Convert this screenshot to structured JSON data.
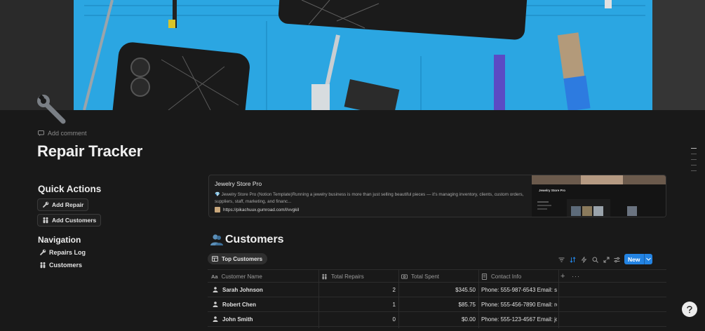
{
  "page": {
    "title": "Repair Tracker",
    "add_comment": "Add comment",
    "icon": "wrench-icon"
  },
  "quick_actions": {
    "heading": "Quick Actions",
    "buttons": [
      {
        "label": "Add Repair",
        "icon": "wrench-icon"
      },
      {
        "label": "Add Customers",
        "icon": "people-icon"
      }
    ]
  },
  "navigation": {
    "heading": "Navigation",
    "links": [
      {
        "label": "Repairs Log",
        "icon": "wrench-icon"
      },
      {
        "label": "Customers",
        "icon": "people-icon"
      }
    ]
  },
  "bookmark": {
    "title": "Jewelry Store Pro",
    "description": "💎 Jewelry Store Pro (Notion Template)Running a jewelry business is more than just selling beautiful pieces — it's managing inventory, clients, custom orders, suppliers, staff, marketing, and financ...",
    "url": "https://pikachuux.gumroad.com/l/vvgkil",
    "thumb_title": "Jewelry Store Pro"
  },
  "database": {
    "title": "Customers",
    "view_tab": "Top Customers",
    "new_label": "New",
    "columns": [
      {
        "label": "Customer Name",
        "icon": "text-icon"
      },
      {
        "label": "Total Repairs",
        "icon": "people-icon"
      },
      {
        "label": "Total Spent",
        "icon": "money-icon"
      },
      {
        "label": "Contact Info",
        "icon": "document-icon"
      }
    ],
    "rows": [
      {
        "name": "Sarah Johnson",
        "repairs": "2",
        "spent": "$345.50",
        "contact": "Phone: 555-987-6543 Email: sar"
      },
      {
        "name": "Robert Chen",
        "repairs": "1",
        "spent": "$85.75",
        "contact": "Phone: 555-456-7890 Email: rob"
      },
      {
        "name": "John Smith",
        "repairs": "0",
        "spent": "$0.00",
        "contact": "Phone: 555-123-4567 Email: joh"
      }
    ]
  },
  "colors": {
    "background": "#191919",
    "accent": "#2383e2",
    "cover_mat": "#2aa7e4"
  }
}
